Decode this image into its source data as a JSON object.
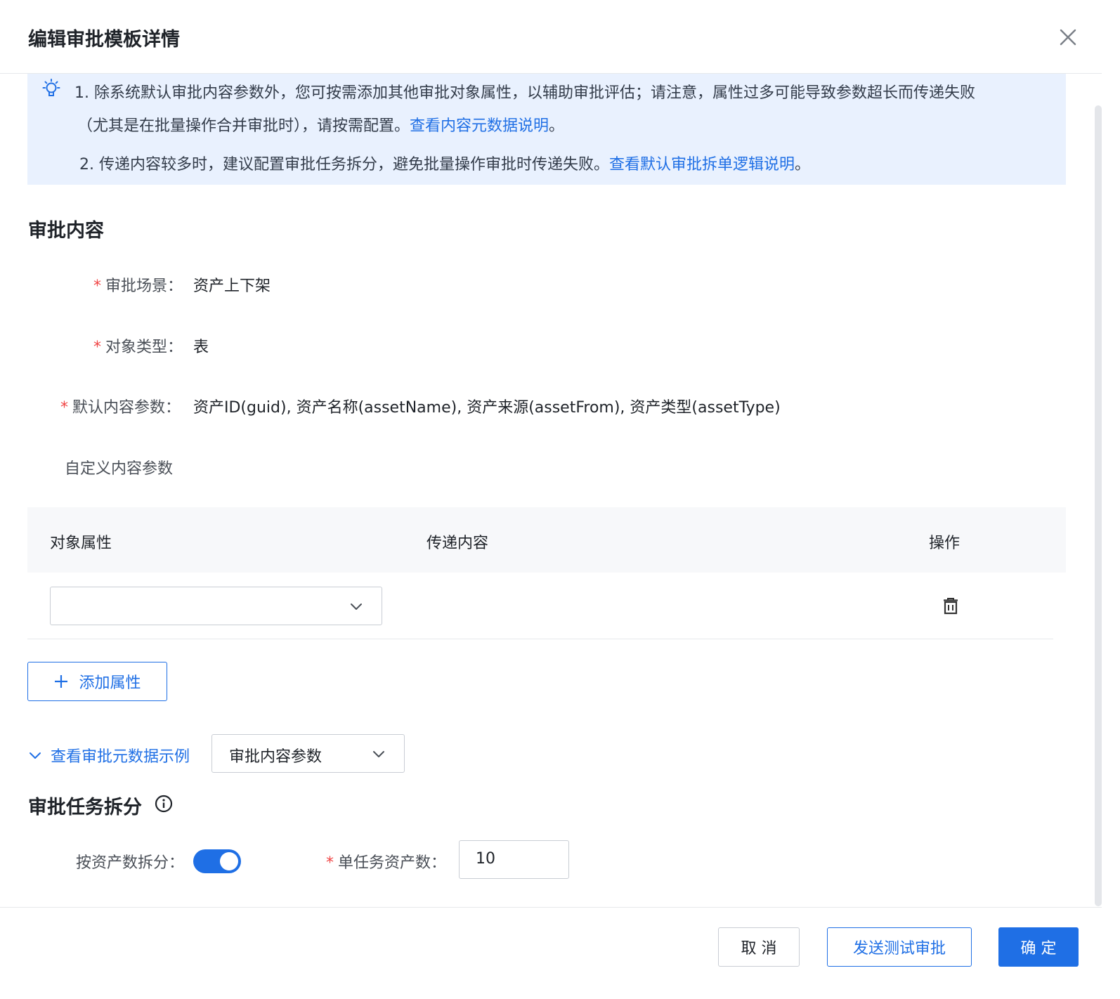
{
  "dialog": {
    "title": "编辑审批模板详情",
    "close_icon": "close-icon"
  },
  "notice": {
    "line1": "1. 除系统默认审批内容参数外，您可按需添加其他审批对象属性，以辅助审批评估；请注意，属性过多可能导致参数超长而传递失败",
    "line2_prefix": "（尤其是在批量操作合并审批时），请按需配置。",
    "line2_link": "查看内容元数据说明",
    "line2_suffix": "。",
    "line3_prefix": "2. 传递内容较多时，建议配置审批任务拆分，避免批量操作审批时传递失败。",
    "line3_link": "查看默认审批拆单逻辑说明",
    "line3_suffix": "。"
  },
  "content_section": {
    "title": "审批内容",
    "scene_label": "审批场景：",
    "scene_value": "资产上下架",
    "object_type_label": "对象类型：",
    "object_type_value": "表",
    "default_params_label": "默认内容参数：",
    "default_params_value": "资产ID(guid), 资产名称(assetName), 资产来源(assetFrom), 资产类型(assetType)",
    "custom_params_label": "自定义内容参数",
    "required_mark": "*"
  },
  "table": {
    "columns": [
      "对象属性",
      "传递内容",
      "操作"
    ],
    "rows": [
      {
        "attribute": "",
        "content": "",
        "action_icon": "delete-icon"
      }
    ]
  },
  "add_attribute_button": {
    "icon": "plus-icon",
    "label": "添加属性"
  },
  "metadata_example": {
    "toggle_label": "查看审批元数据示例",
    "select_value": "审批内容参数"
  },
  "split_section": {
    "title": "审批任务拆分",
    "info_icon": "info-icon",
    "split_by_asset_label": "按资产数拆分：",
    "split_by_asset_enabled": true,
    "per_task_label": "单任务资产数：",
    "per_task_value": "10"
  },
  "footer": {
    "cancel": "取 消",
    "send_test": "发送测试审批",
    "confirm": "确 定"
  },
  "colors": {
    "primary": "#1f6fe5",
    "notice_bg": "#e9f1fe",
    "required": "#f04545"
  }
}
